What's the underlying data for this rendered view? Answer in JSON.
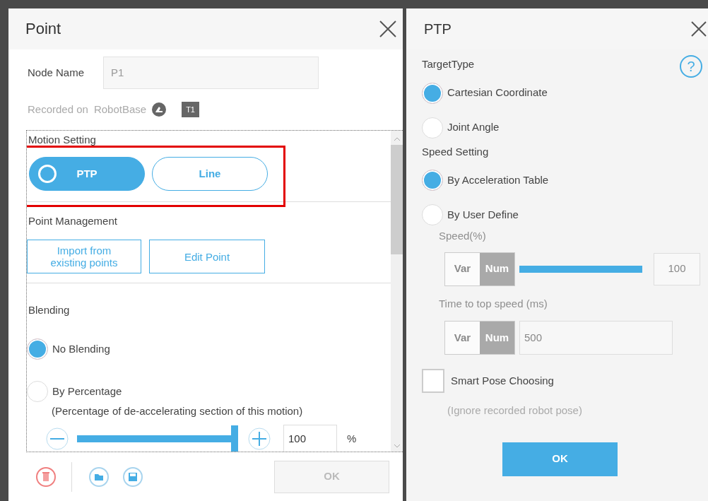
{
  "point_dialog": {
    "title": "Point",
    "node_name": {
      "label": "Node Name",
      "value": "P1"
    },
    "recorded": {
      "label": "Recorded on",
      "frame": "RobotBase",
      "tool_badge": "T1"
    },
    "motion_setting": {
      "label": "Motion Setting",
      "highlighted": true,
      "options": [
        {
          "label": "PTP",
          "selected": true
        },
        {
          "label": "Line",
          "selected": false
        }
      ]
    },
    "point_management": {
      "label": "Point Management",
      "buttons": [
        "Import from existing points",
        "Edit Point"
      ]
    },
    "blending": {
      "label": "Blending",
      "options": [
        {
          "label": "No Blending",
          "selected": true
        },
        {
          "label": "By Percentage",
          "selected": false
        }
      ],
      "note": "(Percentage of de-accelerating section of this motion)",
      "slider": {
        "level": 1,
        "value": "100",
        "unit": "%"
      }
    },
    "ok": {
      "label": "OK",
      "disabled": true
    }
  },
  "ptp_panel": {
    "title": "PTP",
    "help": "?",
    "target_type": {
      "label": "TargetType",
      "options": [
        {
          "label": "Cartesian Coordinate",
          "selected": true
        },
        {
          "label": "Joint Angle",
          "selected": false
        }
      ]
    },
    "speed_setting": {
      "label": "Speed Setting",
      "options": [
        {
          "label": "By Acceleration Table",
          "selected": true
        },
        {
          "label": "By User Define",
          "selected": false
        }
      ]
    },
    "speed": {
      "label": "Speed(%)",
      "disabled": true,
      "modes": [
        {
          "label": "Var",
          "selected": false
        },
        {
          "label": "Num",
          "selected": true
        }
      ],
      "value": "100"
    },
    "time": {
      "label": "Time to top speed  (ms)",
      "disabled": true,
      "modes": [
        {
          "label": "Var",
          "selected": false
        },
        {
          "label": "Num",
          "selected": true
        }
      ],
      "value": "500"
    },
    "smart_pose": {
      "label": "Smart Pose Choosing",
      "checked": false,
      "note": "(Ignore recorded robot pose)"
    },
    "ok": {
      "label": "OK",
      "disabled": false
    }
  }
}
